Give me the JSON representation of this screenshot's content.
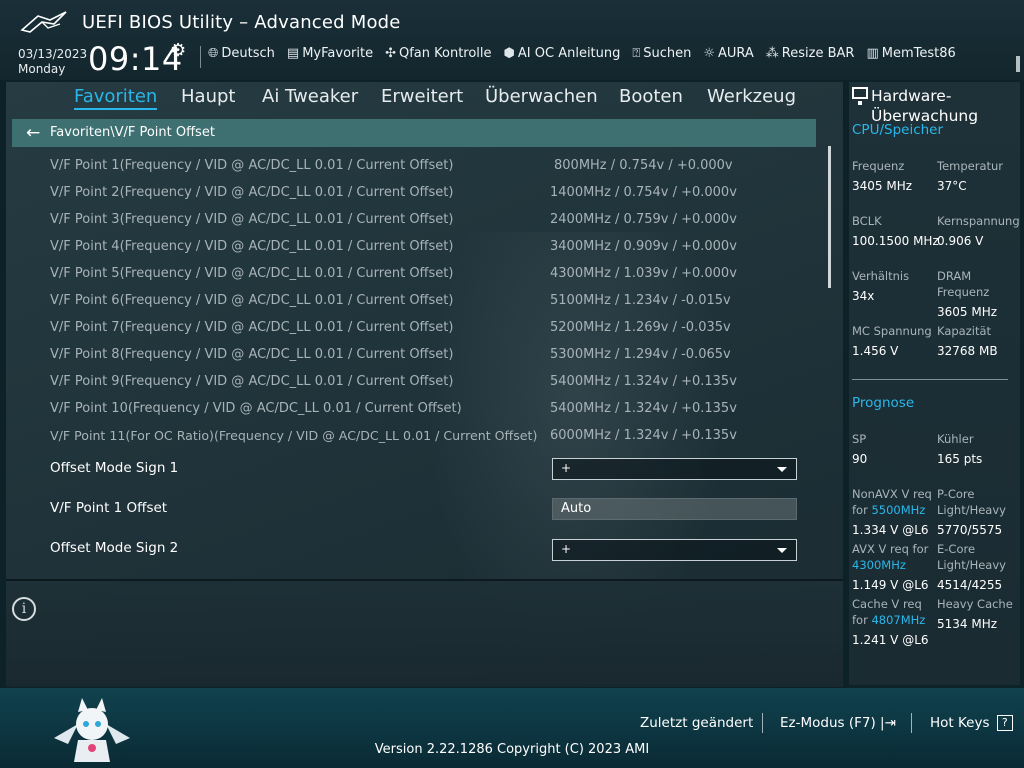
{
  "header": {
    "title": "UEFI BIOS Utility – Advanced Mode",
    "date": "03/13/2023",
    "day": "Monday",
    "time": "09:14",
    "tools": [
      {
        "icon": "globe-icon",
        "label": "Deutsch"
      },
      {
        "icon": "myfavorite-icon",
        "label": "MyFavorite"
      },
      {
        "icon": "fan-icon",
        "label": "Qfan Kontrolle"
      },
      {
        "icon": "ai-chip-icon",
        "label": "AI OC Anleitung"
      },
      {
        "icon": "search-help-icon",
        "label": "Suchen"
      },
      {
        "icon": "aura-icon",
        "label": "AURA"
      },
      {
        "icon": "resize-bar-icon",
        "label": "Resize BAR"
      },
      {
        "icon": "memtest-icon",
        "label": "MemTest86"
      }
    ]
  },
  "nav": {
    "tabs": [
      "Favoriten",
      "Haupt",
      "Ai Tweaker",
      "Erweitert",
      "Überwachen",
      "Booten",
      "Werkzeug"
    ],
    "active": "Favoriten"
  },
  "breadcrumb": "Favoriten\\V/F Point Offset",
  "vf_points": [
    {
      "label": "V/F Point 1(Frequency / VID @ AC/DC_LL 0.01 / Current Offset)",
      "value": "800MHz / 0.754v / +0.000v"
    },
    {
      "label": "V/F Point 2(Frequency / VID @ AC/DC_LL 0.01 / Current Offset)",
      "value": "1400MHz / 0.754v / +0.000v"
    },
    {
      "label": "V/F Point 3(Frequency / VID @ AC/DC_LL 0.01 / Current Offset)",
      "value": "2400MHz / 0.759v / +0.000v"
    },
    {
      "label": "V/F Point 4(Frequency / VID @ AC/DC_LL 0.01 / Current Offset)",
      "value": "3400MHz / 0.909v / +0.000v"
    },
    {
      "label": "V/F Point 5(Frequency / VID @ AC/DC_LL 0.01 / Current Offset)",
      "value": "4300MHz / 1.039v / +0.000v"
    },
    {
      "label": "V/F Point 6(Frequency / VID @ AC/DC_LL 0.01 / Current Offset)",
      "value": "5100MHz / 1.234v / -0.015v"
    },
    {
      "label": "V/F Point 7(Frequency / VID @ AC/DC_LL 0.01 / Current Offset)",
      "value": "5200MHz / 1.269v / -0.035v"
    },
    {
      "label": "V/F Point 8(Frequency / VID @ AC/DC_LL 0.01 / Current Offset)",
      "value": "5300MHz / 1.294v / -0.065v"
    },
    {
      "label": "V/F Point 9(Frequency / VID @ AC/DC_LL 0.01 / Current Offset)",
      "value": "5400MHz / 1.324v / +0.135v"
    },
    {
      "label": "V/F Point 10(Frequency / VID @ AC/DC_LL 0.01 / Current Offset)",
      "value": "5400MHz / 1.324v / +0.135v"
    },
    {
      "label": "V/F Point 11(For OC Ratio)(Frequency / VID @ AC/DC_LL 0.01 / Current Offset)",
      "value": "6000MHz / 1.324v / +0.135v"
    }
  ],
  "options": {
    "offset_sign_1": {
      "label": "Offset Mode Sign 1",
      "value": "+"
    },
    "vf_point_1_offset": {
      "label": "V/F Point 1 Offset",
      "value": "Auto"
    },
    "offset_sign_2": {
      "label": "Offset Mode Sign 2",
      "value": "+"
    }
  },
  "hardware_monitor": {
    "title": "Hardware-Überwachung",
    "cpu_section": "CPU/Speicher",
    "cpu": [
      {
        "label": "Frequenz",
        "value": "3405 MHz"
      },
      {
        "label": "Temperatur",
        "value": "37°C"
      },
      {
        "label": "BCLK",
        "value": "100.1500 MHz"
      },
      {
        "label": "Kernspannung",
        "value": "0.906 V"
      },
      {
        "label": "Verhältnis",
        "value": "34x"
      },
      {
        "label": "DRAM Frequenz",
        "value": "3605 MHz"
      },
      {
        "label": "MC Spannung",
        "value": "1.456 V"
      },
      {
        "label": "Kapazität",
        "value": "32768 MB"
      }
    ],
    "prognose_section": "Prognose",
    "sp_label": "SP",
    "sp_value": "90",
    "kuehler_label": "Kühler",
    "kuehler_value": "165 pts",
    "nonavx_label": "NonAVX V req for",
    "nonavx_freq": "5500MHz",
    "nonavx_value": "1.334 V @L6",
    "pcore_label": "P-Core Light/Heavy",
    "pcore_value": "5770/5575",
    "avx_label": "AVX V req for",
    "avx_freq": "4300MHz",
    "avx_value": "1.149 V @L6",
    "ecore_label": "E-Core Light/Heavy",
    "ecore_value": "4514/4255",
    "cache_label": "Cache V req for",
    "cache_freq": "4807MHz",
    "cache_value": "1.241 V @L6",
    "heavy_cache_label": "Heavy Cache",
    "heavy_cache_value": "5134 MHz"
  },
  "footer": {
    "last_changed": "Zuletzt geändert",
    "ez_mode": "Ez-Modus (F7)",
    "hot_keys": "Hot Keys",
    "hot_keys_glyph": "?",
    "version": "Version 2.22.1286 Copyright (C) 2023 AMI"
  },
  "colors": {
    "accent": "#29b7ea",
    "breadcrumb_bg": "#3e7071",
    "panel_bg": "#1f3239"
  }
}
